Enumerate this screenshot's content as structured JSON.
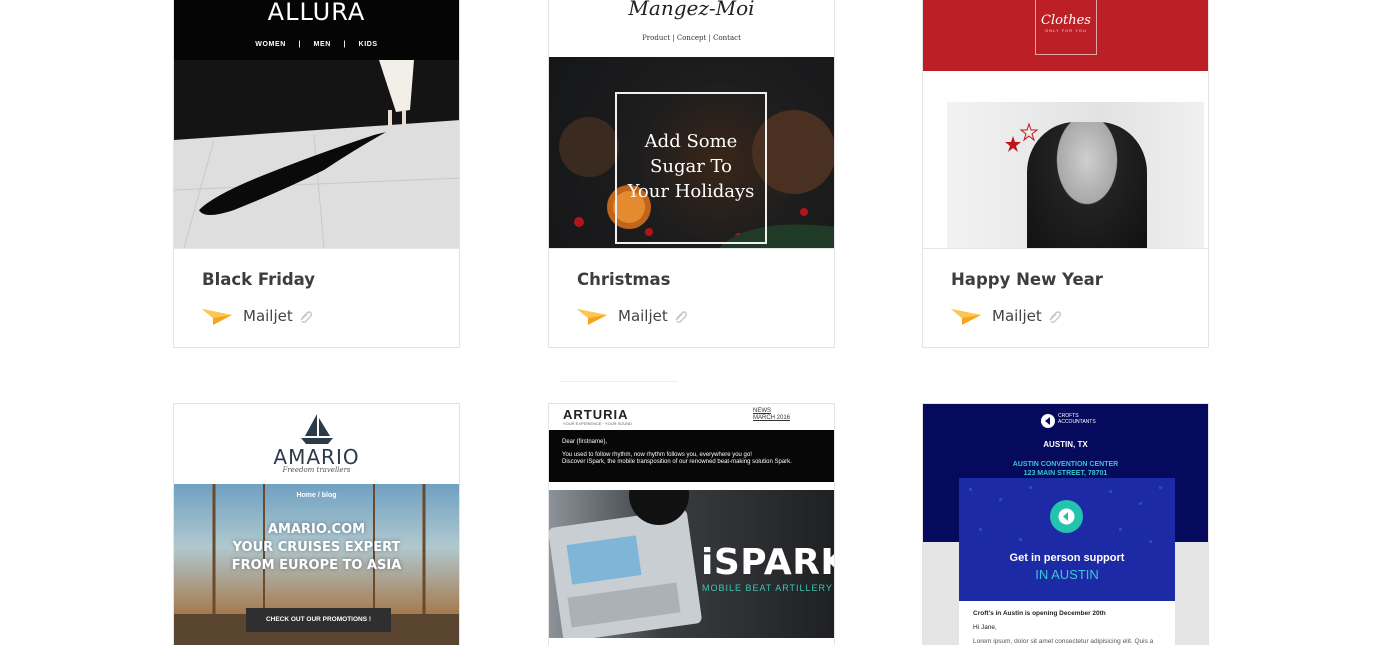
{
  "accent": {
    "mailjet_orange": "#f7a41b",
    "card_border": "#e3e3e3"
  },
  "templates": [
    {
      "title": "Black Friday",
      "provider": "Mailjet",
      "preview": {
        "brand": "ALLURA",
        "nav": "WOMEN | MEN | KIDS"
      }
    },
    {
      "title": "Christmas",
      "provider": "Mailjet",
      "preview": {
        "brand": "Mangez-Moi",
        "nav": "Product | Concept | Contact",
        "line1": "Add Some",
        "line2": "Sugar To",
        "line3": "Your Holidays"
      }
    },
    {
      "title": "Happy New Year",
      "provider": "Mailjet",
      "preview": {
        "brand": "Clothes",
        "tagline": "ONLY FOR YOU"
      }
    },
    {
      "preview": {
        "brand": "AMARIO",
        "tagline": "Freedom travellers",
        "nav": "Home / blog",
        "line1": "AMARIO.COM",
        "line2": "YOUR CRUISES EXPERT",
        "line3": "FROM EUROPE TO ASIA",
        "button": "CHECK OUT OUR PROMOTIONS !"
      }
    },
    {
      "preview": {
        "brand": "ARTURIA",
        "tagline": "YOUR EXPERIENCE · YOUR SOUND",
        "news": "NEWS",
        "date": "MARCH 2016",
        "greeting": "Dear {firstname},",
        "body1": "You used to follow rhythm, now rhythm follows you, everywhere you go!",
        "body2": "Discover iSpark, the mobile transposition of our renowned beat-making solution Spark.",
        "product": "iSPARK",
        "product_sub": "MOBILE BEAT ARTILLERY"
      }
    },
    {
      "preview": {
        "brand_line1": "CROFTS",
        "brand_line2": "ACCOUNTANTS",
        "city": "AUSTIN, TX",
        "venue1": "AUSTIN CONVENTION CENTER",
        "venue2": "123 MAIN STREET, 78701",
        "support": "Get in person support",
        "support_city": "IN AUSTIN",
        "letter_title": "Croft's in Austin is opening December 20th",
        "letter_greeting": "Hi Jane,",
        "letter_body": "Lorem ipsum, dolor sit amet consectetur adipisicing elit. Quis a"
      }
    }
  ]
}
